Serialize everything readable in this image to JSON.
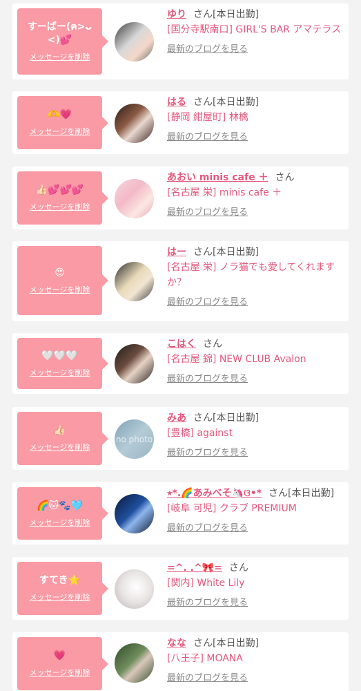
{
  "colors": {
    "bubble": "#f99aa4",
    "name": "#e4577c",
    "background": "#f3f3f3"
  },
  "delete_label": "メッセージを削除",
  "blog_label": "最新のブログを見る",
  "san_label": "さん",
  "items": [
    {
      "message": "すーばー(ฅ>ᴗ<)💕",
      "name": "ゆり",
      "working": "[本日出勤]",
      "shop": "[国分寺駅南口] GIRL'S BAR アマテラス",
      "avatar_icon": "girl-photo"
    },
    {
      "message": "🫶💗",
      "name": "はる",
      "working": "[本日出勤]",
      "shop": "[静岡 紺屋町] 林檎",
      "avatar_icon": "girl-photo"
    },
    {
      "message": "👍🏻💕💕💕",
      "name": "あおい minis cafe ＋",
      "working": "",
      "shop": "[名古屋 栄] minis cafe ＋",
      "avatar_icon": "girl-photo"
    },
    {
      "message": "😍",
      "name": "はー",
      "working": "[本日出勤]",
      "shop": "[名古屋 栄] ノラ猫でも愛してくれますか？",
      "avatar_icon": "girl-photo"
    },
    {
      "message": "🤍🤍🤍",
      "name": "こはく",
      "working": "",
      "shop": "[名古屋 錦] NEW CLUB Avalon",
      "avatar_icon": "girl-photo"
    },
    {
      "message": "👍🏻",
      "name": "みあ",
      "working": "[本日出勤]",
      "shop": "[豊橋] against",
      "avatar_icon": "no-photo",
      "avatar_text": "no photo"
    },
    {
      "message": "🌈🐱🐾🩵",
      "name": "⭒*.🌈あみべそ🦄ଓ•*",
      "working": "[本日出勤]",
      "shop": "[岐阜 可児] クラブ PREMIUM",
      "avatar_icon": "girl-photo"
    },
    {
      "message": "すてき⭐",
      "name": "=^. .^🎀=",
      "working": "",
      "shop": "[関内] White Lily",
      "avatar_icon": "girl-photo"
    },
    {
      "message": "💗",
      "name": "なな",
      "working": "[本日出勤]",
      "shop": "[八王子] MOANA",
      "avatar_icon": "girl-photo"
    }
  ]
}
